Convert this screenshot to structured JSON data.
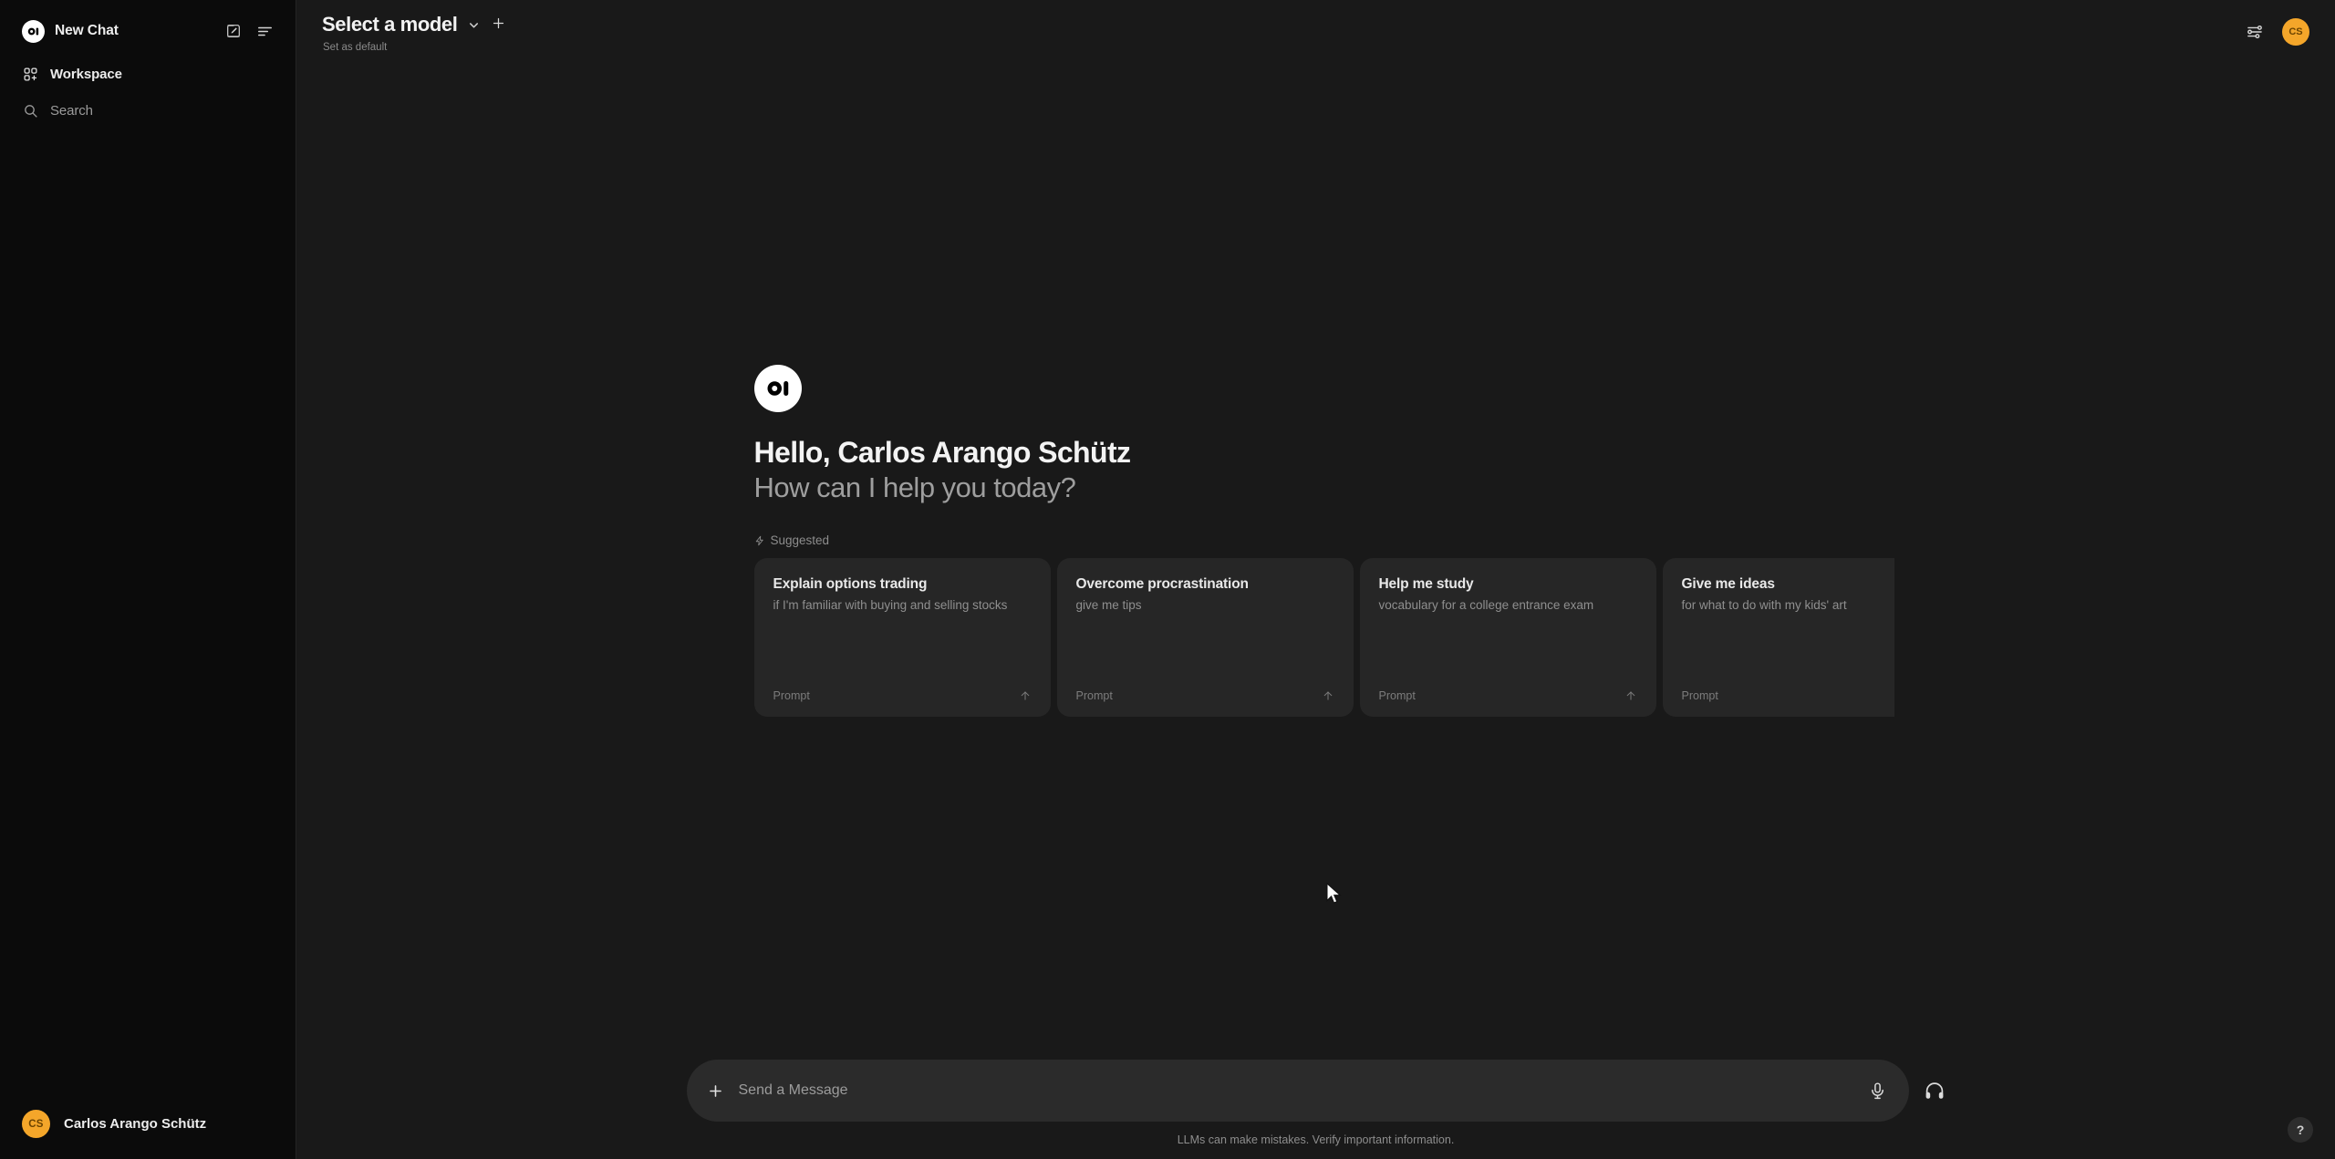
{
  "sidebar": {
    "logo_text": "OI",
    "new_chat_label": "New Chat",
    "new_chat_icon": "openwebui-logo-icon",
    "edit_icon": "new-chat-pencil-icon",
    "panel_icon": "toggle-sidebar-icon",
    "items": [
      {
        "label": "Workspace",
        "icon": "workspace-grid-icon"
      },
      {
        "label": "Search",
        "icon": "search-icon"
      }
    ],
    "user": {
      "initials": "CS",
      "name": "Carlos Arango Schütz"
    }
  },
  "topbar": {
    "model_selector_label": "Select a model",
    "chevron_icon": "chevron-down-icon",
    "add_model_icon": "plus-icon",
    "set_default_label": "Set as default",
    "controls_icon": "adjustments-sliders-icon",
    "avatar_initials": "CS"
  },
  "main": {
    "logo_text": "OI",
    "greeting": "Hello, Carlos Arango Schütz",
    "subgreeting": "How can I help you today?",
    "suggested_label": "Suggested",
    "suggested_icon": "lightning-bolt-icon",
    "cards": [
      {
        "title": "Explain options trading",
        "subtitle": "if I'm familiar with buying and selling stocks",
        "footer": "Prompt",
        "arrow_icon": "arrow-up-icon"
      },
      {
        "title": "Overcome procrastination",
        "subtitle": "give me tips",
        "footer": "Prompt",
        "arrow_icon": "arrow-up-icon"
      },
      {
        "title": "Help me study",
        "subtitle": "vocabulary for a college entrance exam",
        "footer": "Prompt",
        "arrow_icon": "arrow-up-icon"
      },
      {
        "title": "Give me ideas",
        "subtitle": "for what to do with my kids' art",
        "footer": "Prompt",
        "arrow_icon": "arrow-up-icon"
      }
    ]
  },
  "composer": {
    "placeholder": "Send a Message",
    "value": "",
    "attach_icon": "plus-icon",
    "mic_icon": "microphone-icon",
    "voice_icon": "headphones-icon",
    "disclaimer": "LLMs can make mistakes. Verify important information."
  },
  "help": {
    "label": "?",
    "icon": "question-mark-icon"
  },
  "colors": {
    "sidebar_bg": "#0b0b0b",
    "main_bg": "#191919",
    "card_bg": "#262626",
    "composer_bg": "#2b2b2b",
    "accent_avatar": "#f4a62a",
    "text_primary": "#ededed",
    "text_muted": "#8d8d8d"
  }
}
